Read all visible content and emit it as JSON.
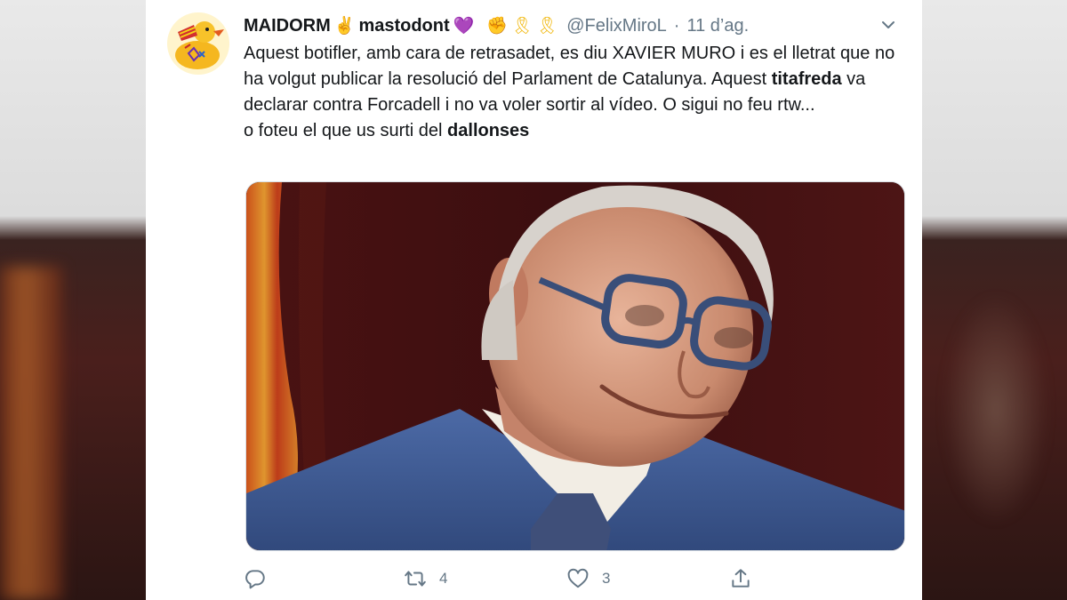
{
  "tweet": {
    "display_name": "MAIDORM",
    "display_name_2": "mastodont",
    "emoji_1": "✌",
    "emoji_2": "💜",
    "emoji_3": "✊",
    "emoji_4": "🎗",
    "emoji_5": "🎗",
    "handle": "@FelixMiroL",
    "separator": "·",
    "time": "11 d’ag.",
    "text": {
      "line1_a": "Aquest botifler, amb cara de retrasadet, es diu XAVIER MURO i es el lletrat que no ha volgut publicar la resolució del Parlament de Catalunya. Aquest ",
      "bold1": "titafreda",
      "line1_b": " va declarar contra Forcadell i no va voler sortir al vídeo. O sigui no feu rtw...",
      "line2_a": "o foteu el que us surti del ",
      "bold2": "dallonses"
    },
    "media_alt": "photo",
    "actions": {
      "reply_icon": "reply-icon",
      "retweet_icon": "retweet-icon",
      "retweet_count": "4",
      "like_icon": "heart-icon",
      "like_count": "3",
      "share_icon": "share-icon"
    }
  },
  "colors": {
    "text": "#14171a",
    "secondary": "#657786",
    "card_bg": "#ffffff"
  }
}
